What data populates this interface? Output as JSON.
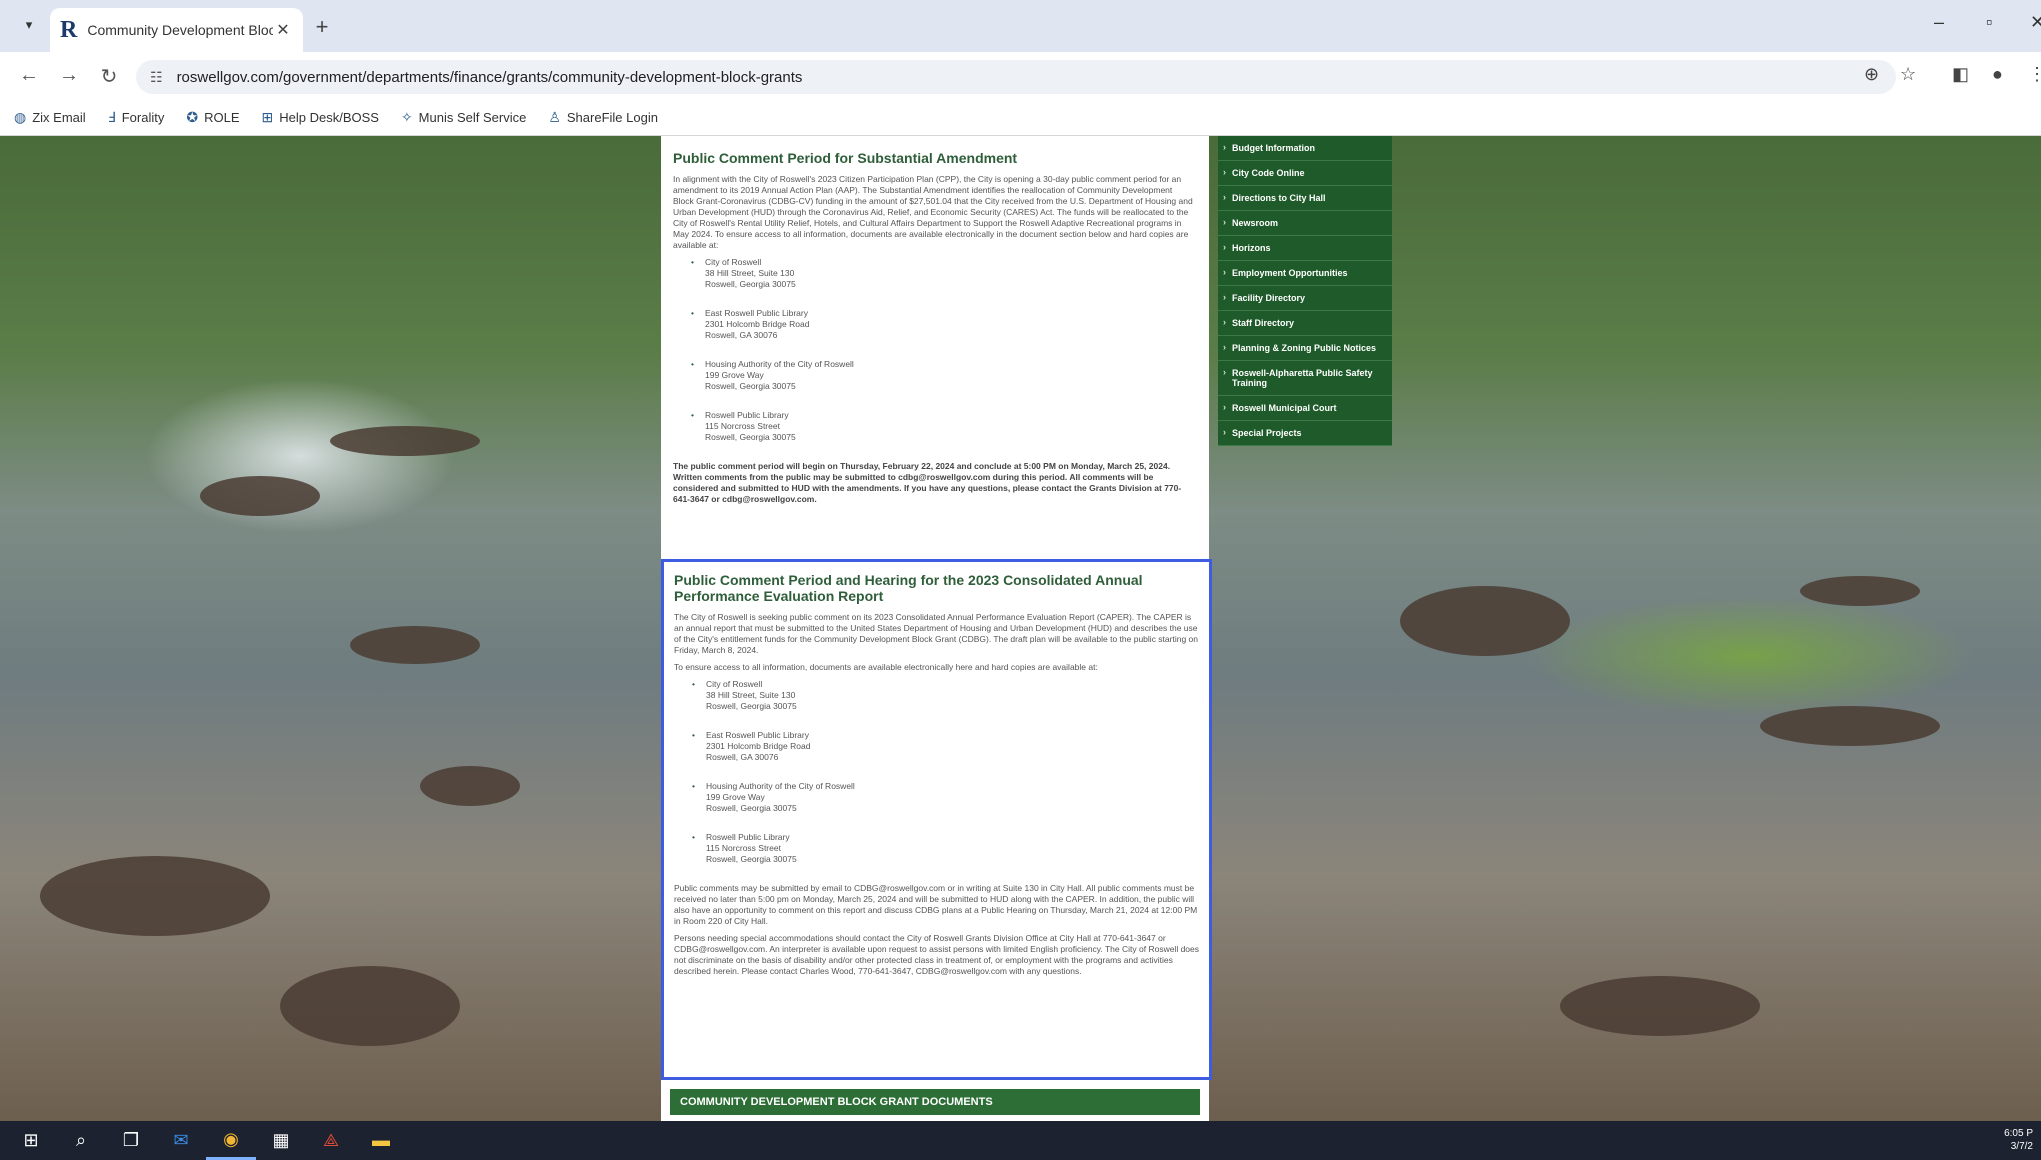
{
  "browser": {
    "tab": {
      "title": "Community Development Bloc",
      "favicon": "R"
    },
    "url": "roswellgov.com/government/departments/finance/grants/community-development-block-grants",
    "bookmarks": [
      {
        "label": "Zix Email",
        "icon": "globe-icon"
      },
      {
        "label": "Forality",
        "icon": "f-icon"
      },
      {
        "label": "ROLE",
        "icon": "seal-icon"
      },
      {
        "label": "Help Desk/BOSS",
        "icon": "help-icon"
      },
      {
        "label": "Munis Self Service",
        "icon": "munis-icon"
      },
      {
        "label": "ShareFile Login",
        "icon": "sharefile-icon"
      }
    ]
  },
  "section1": {
    "title": "Public Comment Period for Substantial Amendment",
    "intro": "In alignment with the City of Roswell's 2023 Citizen Participation Plan (CPP), the City is opening a 30-day public comment period for an amendment to its 2019 Annual Action Plan (AAP). The Substantial Amendment identifies the reallocation of Community Development Block Grant-Coronavirus (CDBG-CV) funding in the amount of $27,501.04 that the City received from the U.S. Department of Housing and Urban Development (HUD) through the Coronavirus Aid, Relief, and Economic Security (CARES) Act. The funds will be reallocated to the City of Roswell's Rental Utility Relief, Hotels, and Cultural Affairs Department to Support the Roswell Adaptive Recreational programs in May 2024. To ensure access to all information, documents are available electronically in the document section below and hard copies are available at:",
    "addresses": [
      [
        "City of Roswell",
        "38 Hill Street, Suite 130",
        "Roswell, Georgia 30075"
      ],
      [
        "East Roswell Public Library",
        "2301 Holcomb Bridge Road",
        "Roswell, GA 30076"
      ],
      [
        "Housing Authority of the City of Roswell",
        "199 Grove Way",
        "Roswell, Georgia 30075"
      ],
      [
        "Roswell Public Library",
        "115 Norcross Street",
        "Roswell, Georgia 30075"
      ]
    ],
    "closing": "The public comment period will begin on Thursday, February 22, 2024 and conclude at 5:00 PM on Monday, March 25, 2024. Written comments from the public may be submitted to cdbg@roswellgov.com during this period. All comments will be considered and submitted to HUD with the amendments. If you have any questions, please contact the Grants Division at 770-641-3647 or cdbg@roswellgov.com."
  },
  "section2": {
    "title": "Public Comment Period and Hearing for the 2023 Consolidated Annual Performance Evaluation Report",
    "intro": "The City of Roswell is seeking public comment on its 2023 Consolidated Annual Performance Evaluation Report (CAPER). The CAPER is an annual report that must be submitted to the United States Department of Housing and Urban Development (HUD) and describes the use of the City's entitlement funds for the Community Development Block Grant (CDBG). The draft plan will be available to the public starting on Friday, March 8, 2024.",
    "access": "To ensure access to all information, documents are available electronically here and hard copies are available at:",
    "addresses": [
      [
        "City of Roswell",
        "38 Hill Street, Suite 130",
        "Roswell, Georgia 30075"
      ],
      [
        "East Roswell Public Library",
        "2301 Holcomb Bridge Road",
        "Roswell, GA 30076"
      ],
      [
        "Housing Authority of the City of Roswell",
        "199 Grove Way",
        "Roswell, Georgia 30075"
      ],
      [
        "Roswell Public Library",
        "115 Norcross Street",
        "Roswell, Georgia 30075"
      ]
    ],
    "comments": "Public comments may be submitted by email to CDBG@roswellgov.com or in writing at Suite 130 in City Hall. All public comments must be received no later than 5:00 pm on Monday, March 25, 2024 and will be submitted to HUD along with the CAPER. In addition, the public will also have an opportunity to comment on this report and discuss CDBG plans at a Public Hearing on Thursday, March 21, 2024 at 12:00 PM in Room 220 of City Hall.",
    "accommodations": "Persons needing special accommodations should contact the City of Roswell Grants Division Office at City Hall at 770-641-3647 or CDBG@roswellgov.com. An interpreter is available upon request to assist persons with limited English proficiency. The City of Roswell does not discriminate on the basis of disability and/or other protected class in treatment of, or employment with the programs and activities described herein. Please contact Charles Wood, 770-641-3647, CDBG@roswellgov.com with any questions."
  },
  "doc_bar": "COMMUNITY DEVELOPMENT BLOCK GRANT DOCUMENTS",
  "side_menu": [
    "Budget Information",
    "City Code Online",
    "Directions to City Hall",
    "Newsroom",
    "Horizons",
    "Employment Opportunities",
    "Facility Directory",
    "Staff Directory",
    "Planning & Zoning Public Notices",
    "Roswell-Alpharetta Public Safety Training",
    "Roswell Municipal Court",
    "Special Projects"
  ],
  "taskbar": {
    "items": [
      "windows-icon",
      "search-icon",
      "task-view-icon",
      "outlook-icon",
      "chrome-icon",
      "calculator-icon",
      "acrobat-icon",
      "file-explorer-icon"
    ],
    "clock_time": "6:05 P",
    "clock_date": "3/7/2"
  }
}
